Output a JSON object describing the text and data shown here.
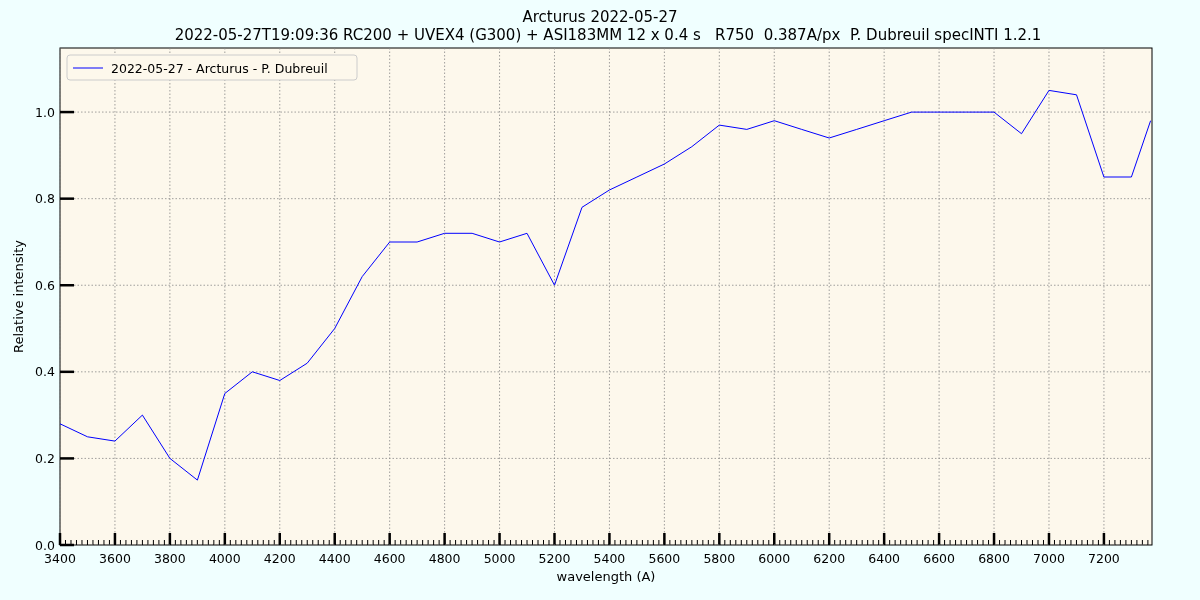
{
  "figure": {
    "title": "Arcturus 2022-05-27",
    "subtitle": "2022-05-27T19:09:36 RC200 + UVEX4 (G300) + ASI183MM 12 x 0.4 s   R750  0.387A/px  P. Dubreuil specINTI 1.2.1",
    "chart_data": {
      "type": "line",
      "grid": true,
      "xlabel": "wavelength (A)",
      "ylabel": "Relative intensity",
      "xlim": [
        3400,
        7375
      ],
      "ylim": [
        0,
        1.148
      ],
      "xticks": [
        3400,
        3600,
        3800,
        4000,
        4200,
        4400,
        4600,
        4800,
        5000,
        5200,
        5400,
        5600,
        5800,
        6000,
        6200,
        6400,
        6600,
        6800,
        7000,
        7200
      ],
      "yticks": [
        {
          "value": 0,
          "label": "0.0"
        },
        {
          "value": 0.2,
          "label": "0.2"
        },
        {
          "value": 0.4,
          "label": "0.4"
        },
        {
          "value": 0.6,
          "label": "0.6"
        },
        {
          "value": 0.8,
          "label": "0.8"
        },
        {
          "value": 1,
          "label": "1.0"
        }
      ],
      "x": [
        3400,
        3500,
        3600,
        3700,
        3800,
        3900,
        4000,
        4100,
        4200,
        4300,
        4400,
        4500,
        4600,
        4700,
        4800,
        4900,
        5000,
        5100,
        5200,
        5300,
        5400,
        5500,
        5600,
        5700,
        5800,
        5900,
        6000,
        6100,
        6200,
        6300,
        6400,
        6500,
        6600,
        6700,
        6800,
        6900,
        7000,
        7100,
        7200,
        7300,
        7370
      ],
      "series": [
        {
          "name": "2022-05-27 - Arcturus - P. Dubreuil",
          "color": "#0000ff",
          "values": [
            0.28,
            0.25,
            0.24,
            0.3,
            0.2,
            0.15,
            0.35,
            0.4,
            0.38,
            0.42,
            0.5,
            0.62,
            0.7,
            0.7,
            0.72,
            0.72,
            0.7,
            0.72,
            0.6,
            0.78,
            0.82,
            0.85,
            0.88,
            0.92,
            0.97,
            0.96,
            0.98,
            0.96,
            0.94,
            0.96,
            0.98,
            1.0,
            1.0,
            1.0,
            1.0,
            0.95,
            1.05,
            1.04,
            0.85,
            0.85,
            0.98
          ]
        }
      ]
    }
  }
}
